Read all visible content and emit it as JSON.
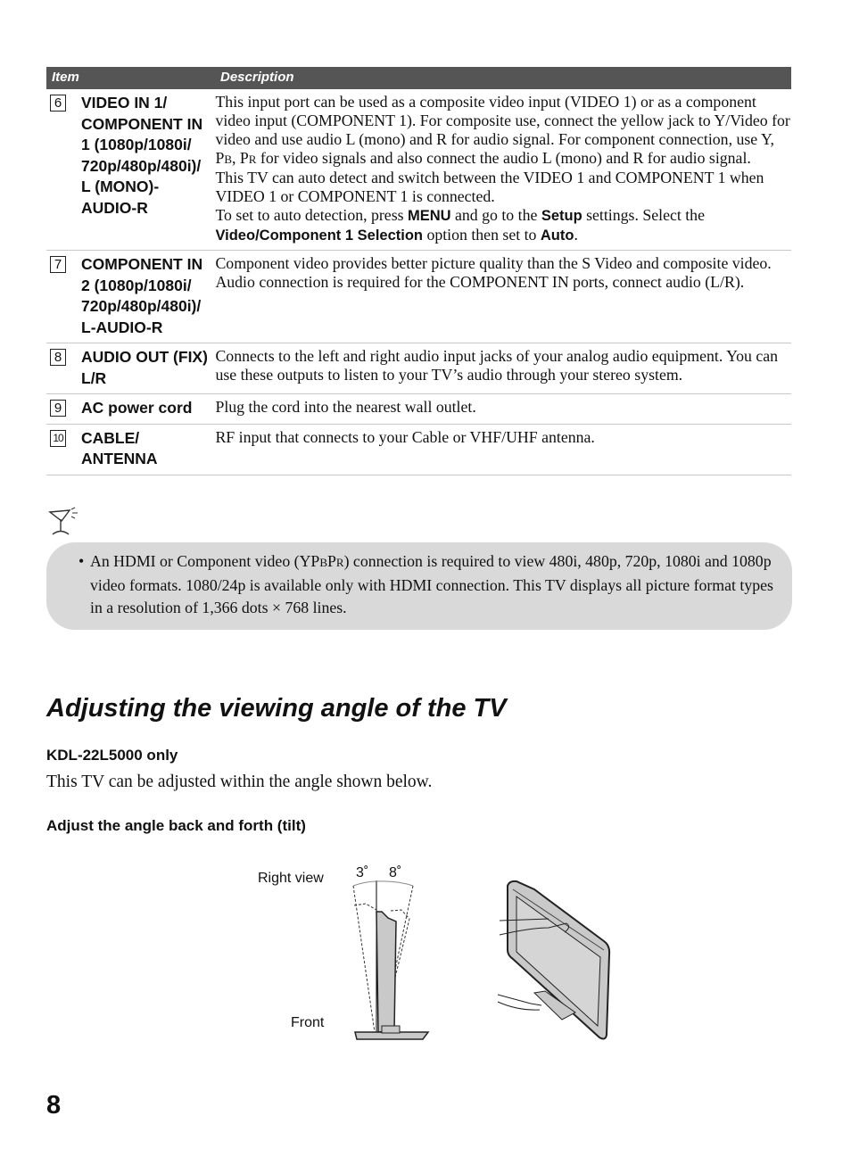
{
  "table": {
    "headers": {
      "item": "Item",
      "description": "Description"
    },
    "rows": [
      {
        "num": "6",
        "item": "VIDEO IN 1/ COMPONENT IN 1 (1080p/1080i/ 720p/480p/480i)/ L (MONO)- AUDIO-R",
        "description": [
          [
            {
              "text": "This input port can be used as a composite video input (VIDEO 1) or as a component video input (COMPONENT 1). For composite use, connect the yellow jack to Y/Video for video and use audio L (mono) and R for audio signal. For component connection, use Y, P"
            },
            {
              "text": "B",
              "style": "sc"
            },
            {
              "text": ", P"
            },
            {
              "text": "R",
              "style": "sc"
            },
            {
              "text": " for video signals and also connect the audio L (mono) and R for audio signal."
            }
          ],
          [
            {
              "text": "This TV can auto detect and switch between the VIDEO 1 and COMPONENT 1 when VIDEO 1 or COMPONENT 1 is connected."
            }
          ],
          [
            {
              "text": "To set to auto detection, press "
            },
            {
              "text": "MENU",
              "style": "bold"
            },
            {
              "text": " and go to the "
            },
            {
              "text": "Setup",
              "style": "bold"
            },
            {
              "text": " settings. Select the "
            },
            {
              "text": "Video/Component 1 Selection",
              "style": "bold"
            },
            {
              "text": " option then set to "
            },
            {
              "text": "Auto",
              "style": "bold"
            },
            {
              "text": "."
            }
          ]
        ]
      },
      {
        "num": "7",
        "item": "COMPONENT IN 2 (1080p/1080i/ 720p/480p/480i)/ L-AUDIO-R",
        "description": [
          [
            {
              "text": "Component video provides better picture quality than the S Video and composite video."
            }
          ],
          [
            {
              "text": "Audio connection is required for the COMPONENT IN ports, connect audio (L/R)."
            }
          ]
        ]
      },
      {
        "num": "8",
        "item": "AUDIO OUT (FIX) L/R",
        "description": [
          [
            {
              "text": "Connects to the left and right audio input jacks of your analog audio equipment. You can use these outputs to listen to your TV’s audio through your stereo system."
            }
          ]
        ]
      },
      {
        "num": "9",
        "item": "AC power cord",
        "description": [
          [
            {
              "text": "Plug the cord into the nearest wall outlet."
            }
          ]
        ]
      },
      {
        "num": "10",
        "item": "CABLE/ ANTENNA",
        "description": [
          [
            {
              "text": "RF input that connects to your Cable or VHF/UHF antenna."
            }
          ]
        ]
      }
    ]
  },
  "tip": {
    "icon": "tip-lamp-icon",
    "bullet": "•",
    "text_parts": [
      {
        "text": "An HDMI or Component video (YP"
      },
      {
        "text": "B",
        "style": "sc"
      },
      {
        "text": "P"
      },
      {
        "text": "R",
        "style": "sc"
      },
      {
        "text": ") connection is required to view 480i, 480p, 720p, 1080i and 1080p video formats. 1080/24p is available only with HDMI connection. This TV displays all picture format types in a resolution of 1,366 dots × 768 lines."
      }
    ],
    "background": "#d9d9d9"
  },
  "section": {
    "title": "Adjusting the viewing angle of the TV",
    "model": "KDL-22L5000 only",
    "intro": "This TV can be adjusted within the angle shown below.",
    "subheading": "Adjust the angle back and forth (tilt)",
    "figure": {
      "right_view": "Right view",
      "front": "Front",
      "angle_back": "3˚",
      "angle_forward": "8˚"
    }
  },
  "page_number": "8",
  "colors": {
    "table_header": "#555555",
    "rule": "#c8c8c8"
  }
}
